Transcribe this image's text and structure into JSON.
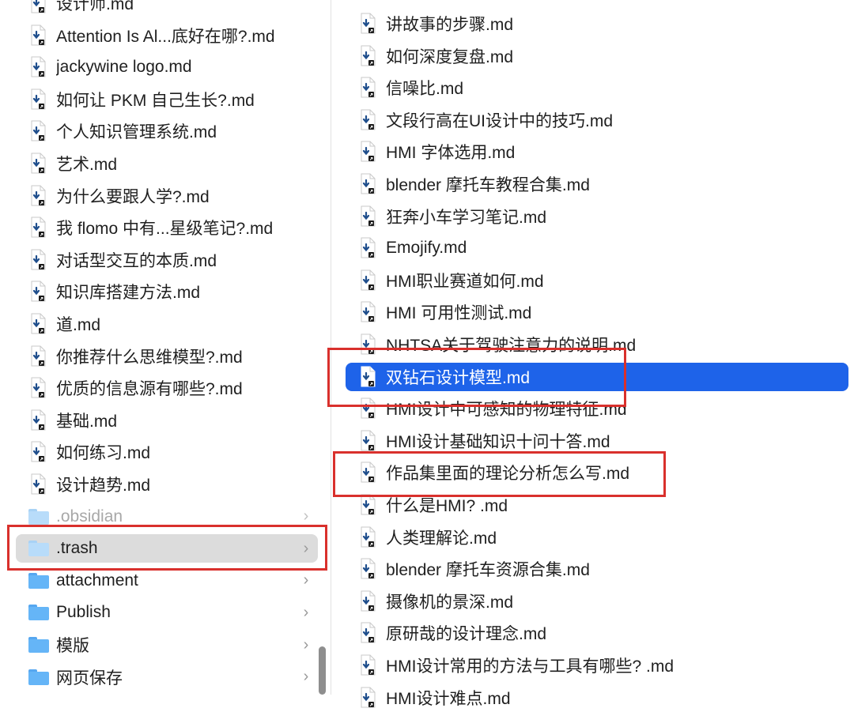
{
  "left_pane": {
    "items": [
      {
        "type": "file",
        "label": "设计师.md"
      },
      {
        "type": "file",
        "label": "Attention Is Al...底好在哪?.md"
      },
      {
        "type": "file",
        "label": "jackywine logo.md"
      },
      {
        "type": "file",
        "label": "如何让 PKM 自己生长?.md"
      },
      {
        "type": "file",
        "label": "个人知识管理系统.md"
      },
      {
        "type": "file",
        "label": "艺术.md"
      },
      {
        "type": "file",
        "label": "为什么要跟人学?.md"
      },
      {
        "type": "file",
        "label": "我 flomo 中有...星级笔记?.md"
      },
      {
        "type": "file",
        "label": "对话型交互的本质.md"
      },
      {
        "type": "file",
        "label": "知识库搭建方法.md"
      },
      {
        "type": "file",
        "label": "道.md"
      },
      {
        "type": "file",
        "label": "你推荐什么思维模型?.md"
      },
      {
        "type": "file",
        "label": "优质的信息源有哪些?.md"
      },
      {
        "type": "file",
        "label": "基础.md"
      },
      {
        "type": "file",
        "label": "如何练习.md"
      },
      {
        "type": "file",
        "label": "设计趋势.md"
      },
      {
        "type": "folder",
        "label": ".obsidian",
        "state": "dim"
      },
      {
        "type": "folder",
        "label": ".trash",
        "state": "hilite"
      },
      {
        "type": "folder",
        "label": "attachment"
      },
      {
        "type": "folder",
        "label": "Publish"
      },
      {
        "type": "folder",
        "label": "模版"
      },
      {
        "type": "folder",
        "label": "网页保存"
      }
    ]
  },
  "right_pane": {
    "items": [
      {
        "type": "file",
        "label": "讲故事的步骤.md"
      },
      {
        "type": "file",
        "label": "如何深度复盘.md"
      },
      {
        "type": "file",
        "label": "信噪比.md"
      },
      {
        "type": "file",
        "label": "文段行高在UI设计中的技巧.md"
      },
      {
        "type": "file",
        "label": "HMI 字体选用.md"
      },
      {
        "type": "file",
        "label": "blender 摩托车教程合集.md"
      },
      {
        "type": "file",
        "label": "狂奔小车学习笔记.md"
      },
      {
        "type": "file",
        "label": "Emojify.md"
      },
      {
        "type": "file",
        "label": "HMI职业赛道如何.md"
      },
      {
        "type": "file",
        "label": "HMI 可用性测试.md"
      },
      {
        "type": "file",
        "label": "NHTSA关于驾驶注意力的说明.md"
      },
      {
        "type": "file",
        "label": "双钻石设计模型.md",
        "state": "selected"
      },
      {
        "type": "file",
        "label": "HMI设计中可感知的物理特征.md"
      },
      {
        "type": "file",
        "label": "HMI设计基础知识十问十答.md"
      },
      {
        "type": "file",
        "label": "作品集里面的理论分析怎么写.md"
      },
      {
        "type": "file",
        "label": "什么是HMI? .md"
      },
      {
        "type": "file",
        "label": "人类理解论.md"
      },
      {
        "type": "file",
        "label": "blender 摩托车资源合集.md"
      },
      {
        "type": "file",
        "label": "摄像机的景深.md"
      },
      {
        "type": "file",
        "label": "原研哉的设计理念.md"
      },
      {
        "type": "file",
        "label": "HMI设计常用的方法与工具有哪些? .md"
      },
      {
        "type": "file",
        "label": "HMI设计难点.md"
      }
    ]
  },
  "icons": {
    "file": "markdown-alias-file-icon",
    "folder": "folder-icon",
    "chevron": "chevron-right-icon"
  },
  "chevron_glyph": "›",
  "colors": {
    "selection": "#1e63e9",
    "hover_row": "#dcdcdc",
    "annotation_red": "#d9302c",
    "folder_blue": "#65b5f7",
    "file_icon_arrow": "#1f4e8c"
  }
}
